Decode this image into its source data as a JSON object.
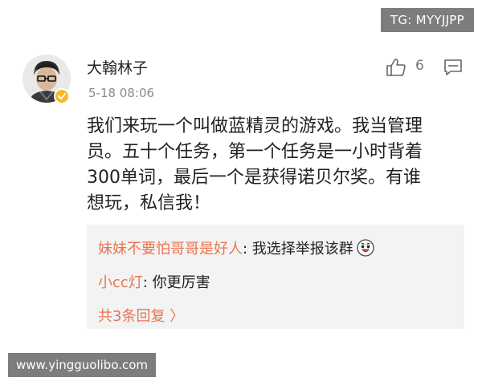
{
  "watermarks": {
    "telegram": "TG: MYYJJPP",
    "url": "www.yingguolibo.com"
  },
  "post": {
    "username": "大翰林子",
    "timestamp": "5-18 08:06",
    "like_count": "6",
    "lines": [
      "我们来玩一个叫做蓝精灵的游戏。我当管理",
      "员。五十个任务，第一个任务是一小时背着",
      "300单词，最后一个是获得诺贝尔奖。有谁",
      "想玩，私信我！"
    ]
  },
  "replies": [
    {
      "author": "妹妹不要怕哥哥是好人",
      "separator": ": ",
      "text": "我选择举报该群"
    },
    {
      "author": "小cc灯",
      "separator": ": ",
      "text": "你更厉害"
    }
  ],
  "more_replies": "共3条回复 〉",
  "colors": {
    "accent": "#eb7350",
    "badge": "#f7b924",
    "reply_bg": "#f3f3f3",
    "watermark_bg": "#7d7d7d"
  },
  "icons": [
    "avatar",
    "verified-badge-icon",
    "like-icon",
    "comment-icon",
    "laughing-emoji-icon"
  ]
}
